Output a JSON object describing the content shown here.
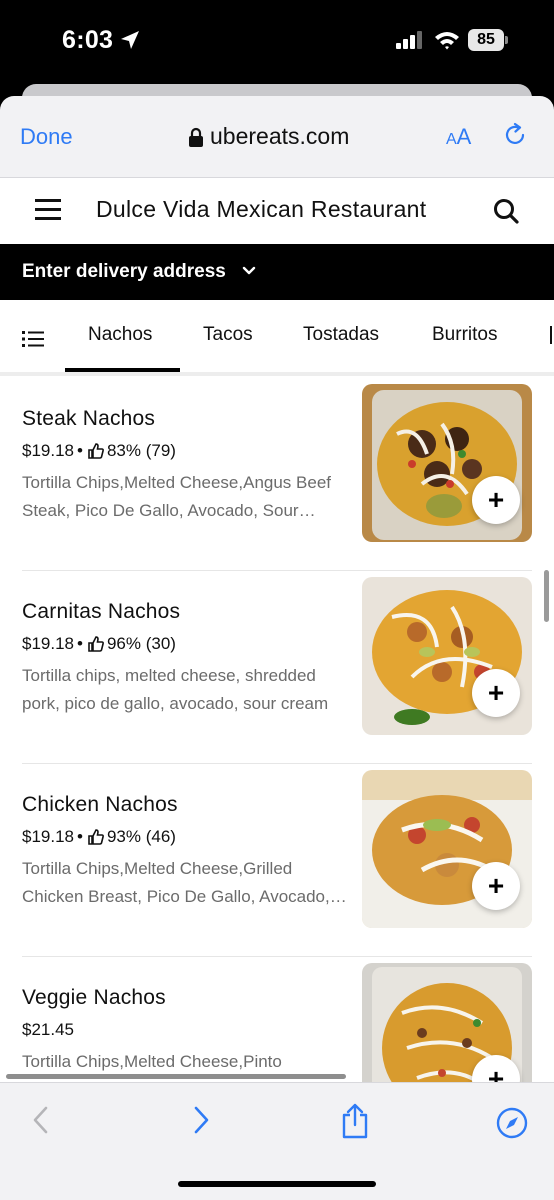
{
  "status_bar": {
    "time": "6:03",
    "battery": "85"
  },
  "browser": {
    "done_label": "Done",
    "url": "ubereats.com",
    "aa_small": "A",
    "aa_large": "A"
  },
  "header": {
    "title": "Dulce Vida Mexican Restaurant"
  },
  "delivery": {
    "label": "Enter delivery address"
  },
  "tabs": [
    {
      "label": "Nachos",
      "active": true
    },
    {
      "label": "Tacos"
    },
    {
      "label": "Tostadas"
    },
    {
      "label": "Burritos"
    }
  ],
  "items": [
    {
      "name": "Steak Nachos",
      "price": "$19.18",
      "rating": "83% (79)",
      "description": "Tortilla Chips,Melted Cheese,Angus Beef Steak, Pico De Gallo, Avocado, Sour Cream"
    },
    {
      "name": "Carnitas Nachos",
      "price": "$19.18",
      "rating": "96% (30)",
      "description": "Tortilla chips, melted cheese, shredded pork, pico de gallo, avocado, sour cream"
    },
    {
      "name": "Chicken Nachos",
      "price": "$19.18",
      "rating": "93% (46)",
      "description": "Tortilla Chips,Melted Cheese,Grilled Chicken Breast, Pico De Gallo, Avocado, Sour Cream"
    },
    {
      "name": "Veggie Nachos",
      "price": "$21.45",
      "rating": "",
      "description": "Tortilla Chips,Melted Cheese,Pinto Beans,Pico De Gallo, Avocado,Corn"
    }
  ],
  "colors": {
    "accent": "#2f7bf5",
    "text": "#111111",
    "muted": "#6b6b6b"
  }
}
